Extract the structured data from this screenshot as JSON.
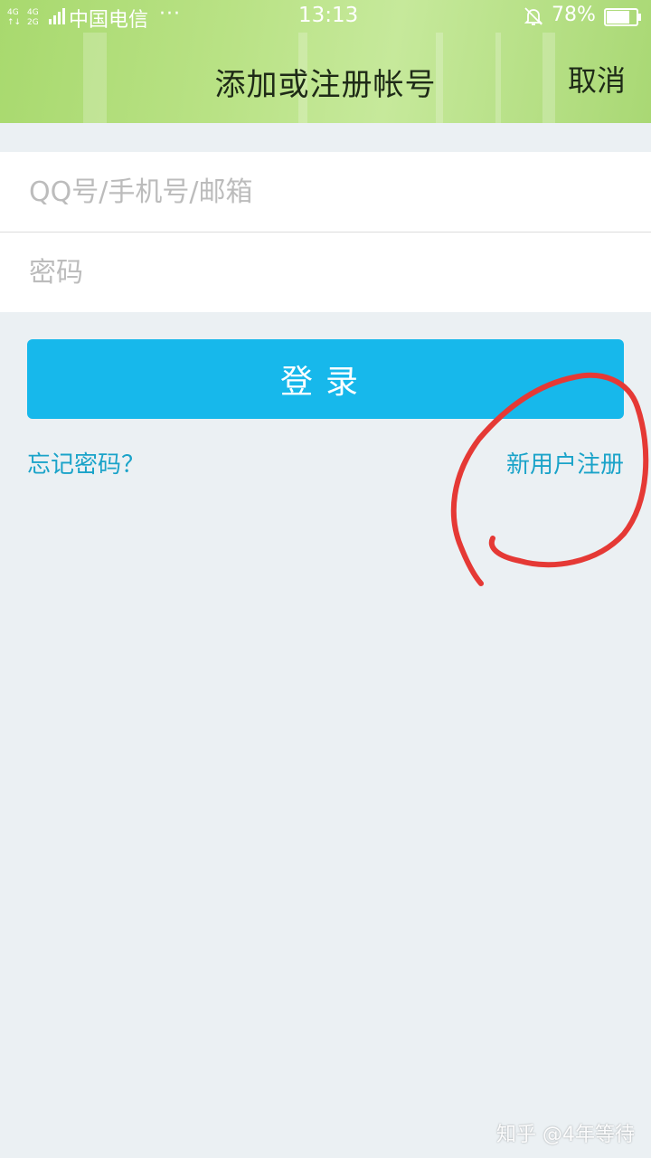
{
  "status_bar": {
    "network_top": "4G",
    "network_bottom": "2G",
    "carrier": "中国电信",
    "more_dots": "···",
    "time": "13:13",
    "battery_percent": "78%",
    "battery_level": 0.78
  },
  "header": {
    "title": "添加或注册帐号",
    "cancel_label": "取消"
  },
  "form": {
    "account_placeholder": "QQ号/手机号/邮箱",
    "account_value": "",
    "password_placeholder": "密码",
    "password_value": ""
  },
  "login_label": "登录",
  "links": {
    "forgot": "忘记密码？",
    "register": "新用户注册"
  },
  "watermark": "知乎 @4年等待",
  "colors": {
    "header_green": "#b3df7e",
    "accent_blue": "#17b8eb",
    "link_blue": "#1aa3c9",
    "annotation_red": "#e53935",
    "background": "#ebf0f3"
  }
}
